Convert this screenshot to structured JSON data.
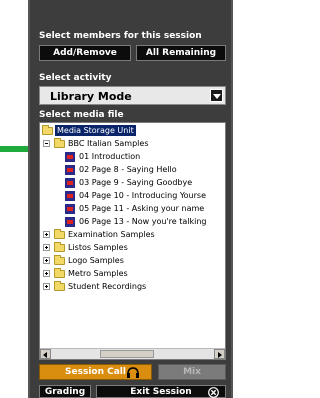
{
  "panel": {
    "members_label": "Select members for this session",
    "add_remove": "Add/Remove",
    "all_remaining": "All Remaining",
    "activity_label": "Select activity",
    "activity_value": "Library Mode",
    "media_label": "Select media file"
  },
  "tree": {
    "root": "Media Storage Unit",
    "bbc_folder": "BBC Italian Samples",
    "files": [
      "01 Introduction",
      "02 Page 8 - Saying Hello",
      "03 Page 9  - Saying Goodbye",
      "04 Page 10 - Introducing Yourse",
      "05 Page 11 - Asking your name",
      "06 Page 13 - Now you're talking"
    ],
    "folders": [
      "Examination Samples",
      "Listos Samples",
      "Logo Samples",
      "Metro Samples",
      "Student Recordings"
    ]
  },
  "bottom": {
    "session_call": "Session Call",
    "mix": "Mix",
    "grading": "Grading",
    "exit_session": "Exit Session"
  },
  "colors": {
    "arrow": "#1faa3c",
    "panel_bg": "#3d3d3d",
    "session_call": "#d98e10",
    "selection": "#0a246a"
  },
  "icons": [
    "green-arrow-icon",
    "folder-icon",
    "media-file-icon",
    "headset-icon",
    "close-icon",
    "dropdown-arrow-icon"
  ]
}
